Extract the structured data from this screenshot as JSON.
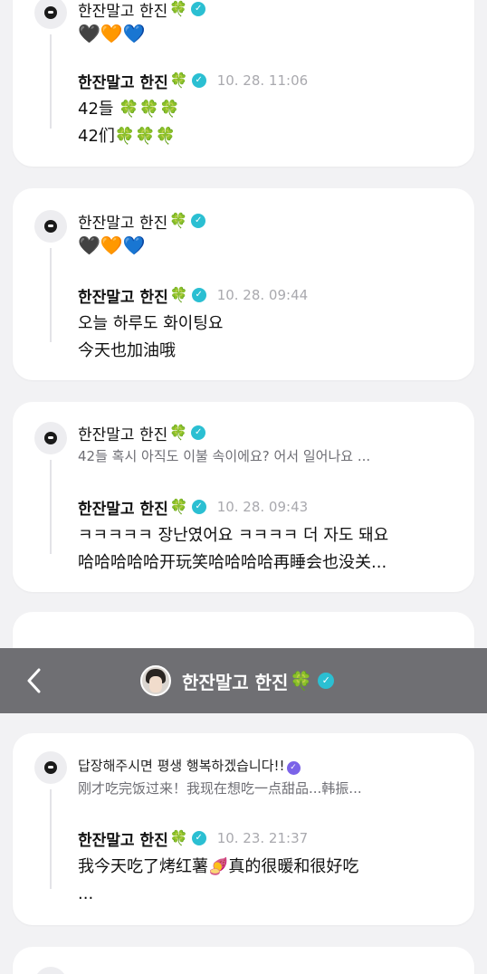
{
  "colors": {
    "background": "#f2f2f4",
    "card": "#ffffff",
    "clover": "#2eb84b",
    "verified_badge": "#2bbfd2",
    "timestamp": "#a9a9ae",
    "topbar": "#6f6f73"
  },
  "author": {
    "name": "한잔말고 한진",
    "emoji_icon": "four-leaf-clover-icon",
    "verified_icon": "verified-badge-icon"
  },
  "topbar": {
    "back_icon": "chevron-left-icon",
    "title": "한잔말고 한진"
  },
  "cards": [
    {
      "original": {
        "name": "한잔말고 한진",
        "text": "🖤🧡💙"
      },
      "reply": {
        "name": "한잔말고 한진",
        "time": "10. 28. 11:06",
        "lines": [
          "42들 🍀🍀🍀",
          "42们🍀🍀🍀"
        ]
      }
    },
    {
      "original": {
        "name": "한잔말고 한진",
        "text": "🖤🧡💙"
      },
      "reply": {
        "name": "한잔말고 한진",
        "time": "10. 28. 09:44",
        "lines": [
          "오늘 하루도 화이팅요",
          "今天也加油哦"
        ]
      }
    },
    {
      "original": {
        "name": "한잔말고 한진",
        "text": "42들 혹시 아직도 이불 속이에요? 어서 일어나요 ..."
      },
      "reply": {
        "name": "한잔말고 한진",
        "time": "10. 28. 09:43",
        "lines": [
          "ㅋㅋㅋㅋㅋ 장난였어요 ㅋㅋㅋㅋ 더 자도 돼요",
          "哈哈哈哈哈开玩笑哈哈哈哈再睡会也没关..."
        ]
      }
    },
    {
      "original": {
        "text": "답장해주시면 평생 행복하겠습니다!!",
        "subtext": "刚才吃完饭过来！我现在想吃一点甜品...韩振..."
      },
      "reply": {
        "name": "한잔말고 한진",
        "time": "10. 23. 21:37",
        "lines": [
          "我今天吃了烤红薯🍠真的很暖和很好吃",
          "..."
        ]
      }
    }
  ]
}
